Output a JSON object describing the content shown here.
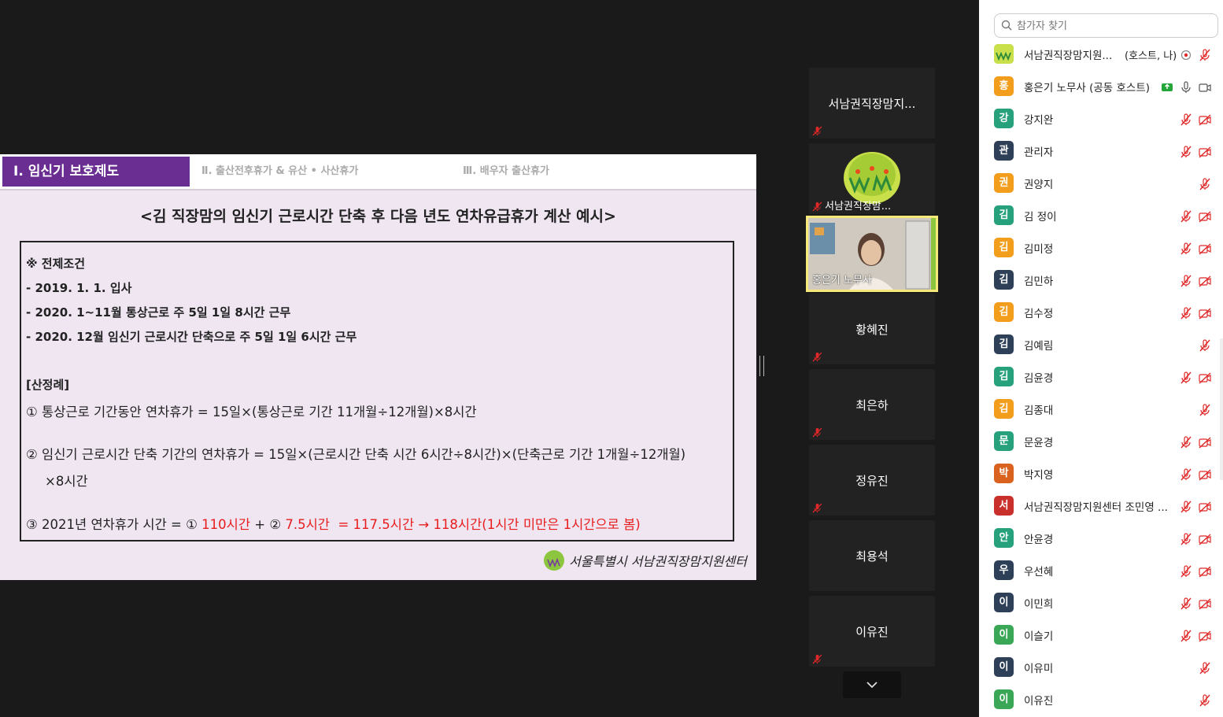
{
  "slide": {
    "tabs": [
      {
        "label": "Ⅰ. 임신기 보호제도",
        "active": true
      },
      {
        "label": "Ⅱ. 출산전후휴가 & 유산 • 사산휴가",
        "active": false
      },
      {
        "label": "Ⅲ. 배우자 출산휴가",
        "active": false
      }
    ],
    "title": "<김 직장맘의 임신기 근로시간 단축 후 다음 년도 연차유급휴가 계산 예시>",
    "conditions_heading": "※ 전제조건",
    "conditions": [
      "- 2019. 1. 1. 입사",
      "- 2020. 1~11월 통상근로 주 5일 1일 8시간 근무",
      "- 2020. 12월 임신기 근로시간 단축으로 주 5일 1일 6시간 근무"
    ],
    "calc_heading": "[산정례]",
    "calc_1": "① 통상근로 기간동안 연차휴가 = 15일×(통상근로 기간 11개월÷12개월)×8시간",
    "calc_2_line1": "② 임신기 근로시간 단축 기간의 연차휴가 = 15일×(근로시간 단축 시간 6시간÷8시간)×(단축근로 기간 1개월÷12개월)",
    "calc_2_line2": "×8시간",
    "calc_3": {
      "prefix": "③ 2021년 연차휴가 시간 = ① ",
      "v1": "110시간",
      "mid": " + ② ",
      "v2": "7.5시간",
      "result": "  = 117.5시간 → 118시간(1시간 미만은 1시간으로 봄)"
    },
    "logo_text": "서울특별시 서남권직장맘지원센터"
  },
  "thumbnails": [
    {
      "name": "서남권직장맘지...",
      "muted": true
    },
    {
      "name": "서남권직장맘...",
      "muted": true,
      "has_logo": true
    },
    {
      "name": "홍은기 노무사",
      "muted": false,
      "video": true,
      "active_speaker": true
    },
    {
      "name": "황혜진",
      "muted": true
    },
    {
      "name": "최은하",
      "muted": true
    },
    {
      "name": "정유진",
      "muted": true
    },
    {
      "name": "최용석",
      "muted": false
    },
    {
      "name": "이유진",
      "muted": true
    }
  ],
  "panel": {
    "search_placeholder": "참가자 찾기",
    "participants": [
      {
        "initial": "",
        "logo": true,
        "name": "서남권직장맘지원...",
        "role": "(호스트, 나)",
        "color": "#8cc63f",
        "icons": [
          "record",
          "mic-off"
        ]
      },
      {
        "initial": "홍",
        "name": "홍은기 노무사 (공동 호스트)",
        "role": "",
        "color": "#f29d1c",
        "icons": [
          "share",
          "mic",
          "video"
        ]
      },
      {
        "initial": "강",
        "name": "강지완",
        "color": "#26a17b",
        "icons": [
          "mic-off",
          "video-off"
        ]
      },
      {
        "initial": "관",
        "name": "관리자",
        "color": "#2e4057",
        "icons": [
          "mic-off",
          "video-off"
        ]
      },
      {
        "initial": "권",
        "name": "권양지",
        "color": "#f29d1c",
        "icons": [
          "mic-off"
        ]
      },
      {
        "initial": "김",
        "name": "김 정이",
        "color": "#26a17b",
        "icons": [
          "mic-off",
          "video-off"
        ]
      },
      {
        "initial": "김",
        "name": "김미정",
        "color": "#f29d1c",
        "icons": [
          "mic-off",
          "video-off"
        ]
      },
      {
        "initial": "김",
        "name": "김민하",
        "color": "#2e4057",
        "icons": [
          "mic-off",
          "video-off"
        ]
      },
      {
        "initial": "김",
        "name": "김수정",
        "color": "#f29d1c",
        "icons": [
          "mic-off",
          "video-off"
        ]
      },
      {
        "initial": "김",
        "name": "김예림",
        "color": "#2e4057",
        "icons": [
          "mic-off"
        ]
      },
      {
        "initial": "김",
        "name": "김윤경",
        "color": "#26a17b",
        "icons": [
          "mic-off",
          "video-off"
        ]
      },
      {
        "initial": "김",
        "name": "김종대",
        "color": "#f29d1c",
        "icons": [
          "mic-off"
        ]
      },
      {
        "initial": "문",
        "name": "문윤경",
        "color": "#26a17b",
        "icons": [
          "mic-off",
          "video-off"
        ]
      },
      {
        "initial": "박",
        "name": "박지영",
        "color": "#d9631e",
        "icons": [
          "mic-off",
          "video-off"
        ]
      },
      {
        "initial": "서",
        "name": "서남권직장맘지원센터 조민영 ...",
        "color": "#c9302c",
        "icons": [
          "mic-off",
          "video-off"
        ]
      },
      {
        "initial": "안",
        "name": "안윤경",
        "color": "#26a17b",
        "icons": [
          "mic-off",
          "video-off"
        ]
      },
      {
        "initial": "우",
        "name": "우선혜",
        "color": "#2e4057",
        "icons": [
          "mic-off",
          "video-off"
        ]
      },
      {
        "initial": "이",
        "name": "이민희",
        "color": "#2e4057",
        "icons": [
          "mic-off",
          "video-off"
        ]
      },
      {
        "initial": "이",
        "name": "이슬기",
        "color": "#3aa757",
        "icons": [
          "mic-off",
          "video-off"
        ]
      },
      {
        "initial": "이",
        "name": "이유미",
        "color": "#2e4057",
        "icons": [
          "mic-off"
        ]
      },
      {
        "initial": "이",
        "name": "이유진",
        "color": "#3aa757",
        "icons": [
          "mic-off"
        ]
      }
    ]
  }
}
